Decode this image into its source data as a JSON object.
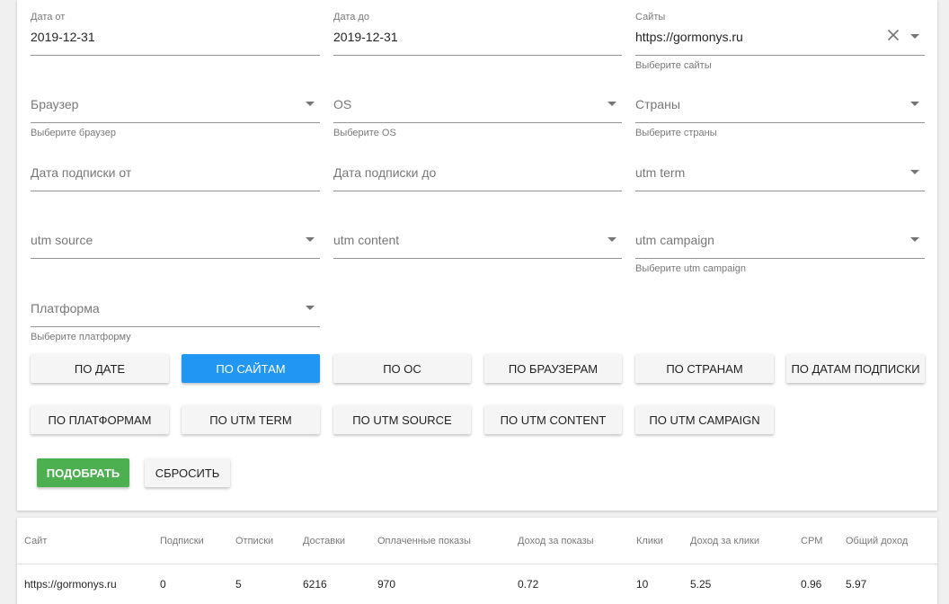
{
  "filters": {
    "date_from": {
      "label": "Дата от",
      "value": "2019-12-31"
    },
    "date_to": {
      "label": "Дата до",
      "value": "2019-12-31"
    },
    "sites": {
      "label": "Сайты",
      "value": "https://gormonys.ru",
      "helper": "Выберите сайты"
    },
    "browser": {
      "placeholder": "Браузер",
      "helper": "Выберите браузер"
    },
    "os": {
      "placeholder": "OS",
      "helper": "Выберите OS"
    },
    "countries": {
      "placeholder": "Страны",
      "helper": "Выберите страны"
    },
    "sub_date_from": {
      "placeholder": "Дата подписки от"
    },
    "sub_date_to": {
      "placeholder": "Дата подписки до"
    },
    "utm_term": {
      "placeholder": "utm term"
    },
    "utm_source": {
      "placeholder": "utm source"
    },
    "utm_content": {
      "placeholder": "utm content"
    },
    "utm_campaign": {
      "placeholder": "utm campaign",
      "helper": "Выберите utm campaign"
    },
    "platform": {
      "placeholder": "Платформа",
      "helper": "Выберите платформу"
    }
  },
  "groupings": [
    {
      "label": "По дате",
      "active": false
    },
    {
      "label": "По сайтам",
      "active": true
    },
    {
      "label": "По ОС",
      "active": false
    },
    {
      "label": "По браузерам",
      "active": false
    },
    {
      "label": "По странам",
      "active": false
    },
    {
      "label": "По датам подписки",
      "active": false
    },
    {
      "label": "По платформам",
      "active": false
    },
    {
      "label": "По UTM TERM",
      "active": false
    },
    {
      "label": "По UTM SOURCE",
      "active": false
    },
    {
      "label": "По UTM CONTENT",
      "active": false
    },
    {
      "label": "По UTM CAMPAIGN",
      "active": false
    }
  ],
  "actions": {
    "submit": "Подобрать",
    "reset": "Сбросить"
  },
  "colors": {
    "primary": "#2196f3",
    "success": "#4caf50"
  },
  "table": {
    "headers": [
      "Сайт",
      "Подписки",
      "Отписки",
      "Доставки",
      "Оплаченные показы",
      "Доход за показы",
      "Клики",
      "Доход за клики",
      "CPM",
      "Общий доход"
    ],
    "rows": [
      [
        "https://gormonys.ru",
        "0",
        "5",
        "6216",
        "970",
        "0.72",
        "10",
        "5.25",
        "0.96",
        "5.97"
      ]
    ]
  }
}
